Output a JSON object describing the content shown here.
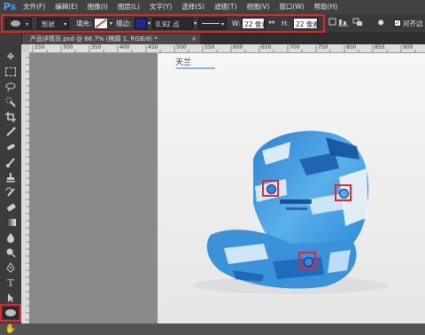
{
  "app": {
    "logo": "Ps"
  },
  "menu": [
    "文件(F)",
    "编辑(E)",
    "图像(I)",
    "图层(L)",
    "文字(Y)",
    "选择(S)",
    "滤镜(T)",
    "视图(V)",
    "窗口(W)",
    "帮助(H)"
  ],
  "options": {
    "shape_mode": "形状",
    "fill_label": "填充:",
    "stroke_label": "描边:",
    "stroke_width": "0.92 点",
    "w_label": "W:",
    "w_value": "22 像素",
    "h_label": "H:",
    "h_value": "22 像素",
    "align_edges": "对齐边"
  },
  "document": {
    "tab_title": "产品详情页.psd @ 66.7% (椭圆 1, RGB/8) *",
    "heading": "天兰"
  },
  "rulers": {
    "h_ticks": [
      "250",
      "300",
      "350",
      "400",
      "450",
      "500",
      "550",
      "600",
      "650",
      "700",
      "750",
      "800",
      "850",
      "900"
    ]
  },
  "colors": {
    "highlight": "#e8262a",
    "stroke_swatch": "#1e2a8c",
    "cap_blue": "#3a92d8"
  }
}
